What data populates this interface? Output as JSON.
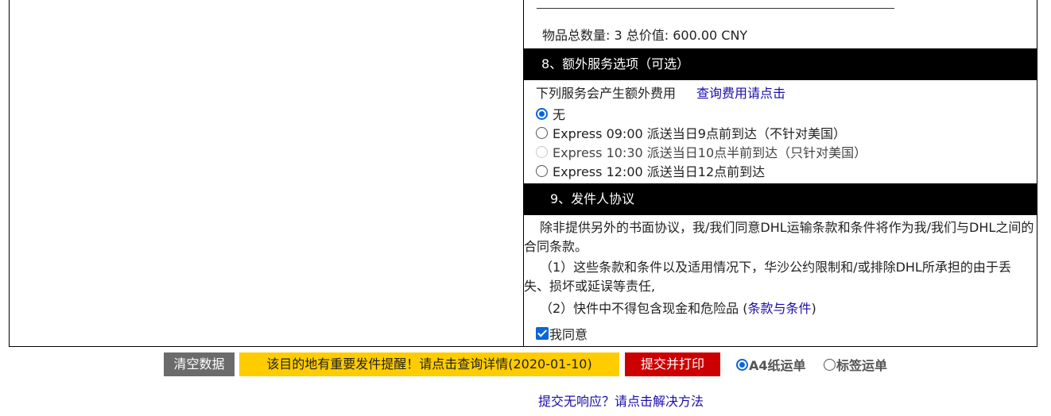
{
  "summary": {
    "label": "物品总数量: 3 总价值: 600.00 CNY"
  },
  "section8": {
    "title": "8、额外服务选项（可选）",
    "note": "下列服务会产生额外费用",
    "link": "查询费用请点击",
    "options": [
      {
        "label": "无",
        "selected": true,
        "disabled": false
      },
      {
        "label": "Express 09:00 派送当日9点前到达（不针对美国）",
        "selected": false,
        "disabled": false
      },
      {
        "label": "Express 10:30 派送当日10点半前到达（只针对美国）",
        "selected": false,
        "disabled": true
      },
      {
        "label": "Express 12:00 派送当日12点前到达",
        "selected": false,
        "disabled": false
      }
    ]
  },
  "section9": {
    "title": "9、发件人协议",
    "para1": "除非提供另外的书面协议，我/我们同意DHL运输条款和条件将作为我/我们与DHL之间的合同条款。",
    "para2": "（1）这些条款和条件以及适用情况下，华沙公约限制和/或排除DHL所承担的由于丢失、损坏或延误等责任,",
    "para3_prefix": "（2）快件中不得包含现金和危险品 (",
    "para3_link": "条款与条件",
    "para3_suffix": ")",
    "agree_label": "我同意",
    "agree_checked": true
  },
  "actions": {
    "clear": "清空数据",
    "alert": "该目的地有重要发件提醒！请点击查询详情(2020-01-10)",
    "submit": "提交并打印",
    "format_options": [
      {
        "label": "A4纸运单",
        "selected": true
      },
      {
        "label": "标签运单",
        "selected": false
      }
    ],
    "help_link": "提交无响应？请点击解决方法"
  },
  "colors": {
    "section_bar": "#000000",
    "link": "#1a0dab",
    "clear_button": "#6b6b6b",
    "alert_button": "#ffcc00",
    "submit_button": "#cc0000",
    "accent": "#0a66d8"
  }
}
